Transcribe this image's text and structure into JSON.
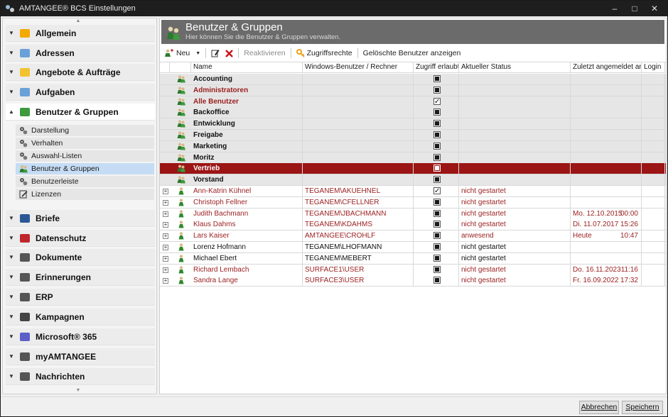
{
  "window": {
    "title": "AMTANGEE® BCS Einstellungen",
    "controls": [
      "–",
      "□",
      "✕"
    ]
  },
  "sidebar": {
    "groups": [
      {
        "label": "Allgemein",
        "icon": "allgemein-icon"
      },
      {
        "label": "Adressen",
        "icon": "address-book-icon"
      },
      {
        "label": "Angebote & Aufträge",
        "icon": "offers-icon"
      },
      {
        "label": "Aufgaben",
        "icon": "tasks-icon"
      },
      {
        "label": "Benutzer & Gruppen",
        "icon": "users-groups-icon"
      },
      {
        "label": "Briefe",
        "icon": "word-icon"
      },
      {
        "label": "Datenschutz",
        "icon": "privacy-icon"
      },
      {
        "label": "Dokumente",
        "icon": "documents-icon"
      },
      {
        "label": "Erinnerungen",
        "icon": "reminders-icon"
      },
      {
        "label": "ERP",
        "icon": "cart-icon"
      },
      {
        "label": "Kampagnen",
        "icon": "campaign-icon"
      },
      {
        "label": "Microsoft® 365",
        "icon": "microsoft365-icon"
      },
      {
        "label": "myAMTANGEE",
        "icon": "dashboard-icon"
      },
      {
        "label": "Nachrichten",
        "icon": "mail-icon"
      }
    ],
    "subitems": [
      {
        "label": "Darstellung"
      },
      {
        "label": "Verhalten"
      },
      {
        "label": "Auswahl-Listen"
      },
      {
        "label": "Benutzer & Gruppen"
      },
      {
        "label": "Benutzerleiste"
      },
      {
        "label": "Lizenzen"
      }
    ]
  },
  "header": {
    "title": "Benutzer & Gruppen",
    "subtitle": "Hier können Sie die Benutzer & Gruppen verwalten."
  },
  "toolbar": {
    "new": "Neu",
    "reactivate": "Reaktivieren",
    "rights": "Zugriffsrechte",
    "deleted": "Gelöschte Benutzer anzeigen"
  },
  "columns": {
    "name": "Name",
    "windows": "Windows-Benutzer / Rechner",
    "access": "Zugriff erlaubt",
    "status": "Aktueller Status",
    "last": "Zuletzt angemeldet am",
    "login": "Login"
  },
  "groups": [
    {
      "name": "Accounting",
      "access": "filled",
      "red": false
    },
    {
      "name": "Administratoren",
      "access": "filled",
      "red": true
    },
    {
      "name": "Alle Benutzer",
      "access": "checked",
      "red": true
    },
    {
      "name": "Backoffice",
      "access": "filled",
      "red": false
    },
    {
      "name": "Entwicklung",
      "access": "filled",
      "red": false
    },
    {
      "name": "Freigabe",
      "access": "filled",
      "red": false
    },
    {
      "name": "Marketing",
      "access": "filled",
      "red": false
    },
    {
      "name": "Moritz",
      "access": "filled",
      "red": false
    },
    {
      "name": "Vertrieb",
      "access": "filled",
      "red": false,
      "selected": true
    },
    {
      "name": "Vorstand",
      "access": "filled",
      "red": false
    }
  ],
  "users": [
    {
      "name": "Ann-Katrin Kühnel",
      "windows": "TEGANEM\\AKUEHNEL",
      "access": "checked",
      "status": "nicht gestartet",
      "date": "",
      "time": "",
      "red": true
    },
    {
      "name": "Christoph Fellner",
      "windows": "TEGANEM\\CFELLNER",
      "access": "filled",
      "status": "nicht gestartet",
      "date": "",
      "time": "",
      "red": true
    },
    {
      "name": "Judith Bachmann",
      "windows": "TEGANEM\\JBACHMANN",
      "access": "filled",
      "status": "nicht gestartet",
      "date": "Mo. 12.10.2015",
      "time": "00:00",
      "red": true
    },
    {
      "name": "Klaus Dahms",
      "windows": "TEGANEM\\KDAHMS",
      "access": "filled",
      "status": "nicht gestartet",
      "date": "Di.  11.07.2017",
      "time": "15:26",
      "red": true
    },
    {
      "name": "Lars Kaiser",
      "windows": "AMTANGEE\\CROHLF",
      "access": "filled",
      "status": "anwesend",
      "date": "Heute",
      "time": "10:47",
      "red": true
    },
    {
      "name": "Lorenz Hofmann",
      "windows": "TEGANEM\\LHOFMANN",
      "access": "filled",
      "status": "nicht gestartet",
      "date": "",
      "time": "",
      "red": false
    },
    {
      "name": "Michael Ebert",
      "windows": "TEGANEM\\MEBERT",
      "access": "filled",
      "status": "nicht gestartet",
      "date": "",
      "time": "",
      "red": false
    },
    {
      "name": "Richard Lembach",
      "windows": "SURFACE1\\USER",
      "access": "filled",
      "status": "nicht gestartet",
      "date": "Do.  16.11.2023",
      "time": "11:16",
      "red": true
    },
    {
      "name": "Sandra Lange",
      "windows": "SURFACE3\\USER",
      "access": "filled",
      "status": "nicht gestartet",
      "date": "Fr.   16.09.2022",
      "time": "17:32",
      "red": true
    }
  ],
  "footer": {
    "cancel": "Abbrechen",
    "save": "Speichern"
  },
  "colors": {
    "selected_row": "#9b1515",
    "red_text": "#9a1e1e",
    "header_bg": "#6b6b6b",
    "selected_subitem": "#c5dcf4"
  }
}
